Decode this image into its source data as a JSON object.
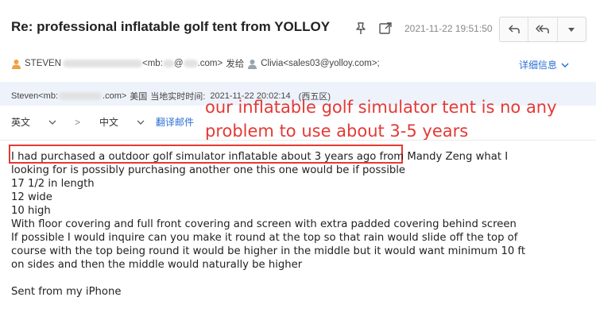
{
  "header": {
    "subject": "Re: professional inflatable golf tent from YOLLOY",
    "timestamp": "2021-11-22 19:51:50",
    "icons": [
      "pin-icon",
      "open-in-window-icon",
      "reply-icon",
      "reply-all-icon",
      "more-dropdown-icon"
    ]
  },
  "sender_row": {
    "from_prefix": "STEVEN",
    "from_suffix": "<mb:",
    "from_mid": "@",
    "from_end": ".com>",
    "sent_to_label": "发给",
    "recipient": "Clivia<sales03@yolloy.com>;",
    "details_label": "详细信息"
  },
  "quoted_sender": {
    "name_prefix": "Steven<mb:",
    "name_suffix": ".com>",
    "region": "美国",
    "local_time_label": "当地实时时间:",
    "local_time": "2021-11-22 20:02:14",
    "timezone": "(西五区)"
  },
  "translate": {
    "source_lang": "英文",
    "arrow": ">",
    "target_lang": "中文",
    "translate_label": "翻译邮件"
  },
  "annotation": {
    "line1": "our inflatable golf simulator tent is no any",
    "line2": "problem to use about 3-5 years",
    "color": "#e53935"
  },
  "body": {
    "lines": [
      "I had purchased a outdoor golf simulator inflatable about 3 years ago from Mandy Zeng what I",
      "looking for is possibly purchasing another one this one would be if possible",
      "17 1/2 in length",
      "12 wide",
      "10 high",
      "With floor covering and full front covering and screen with extra padded covering behind screen",
      "If possible I would inquire can you make it round at the top so that rain would slide off the top of",
      "course with the top being round it would be higher in the middle but it would want minimum 10 ft",
      "on sides and then the middle would naturally be higher",
      "",
      "Sent from my iPhone"
    ]
  },
  "colors": {
    "accent_blue": "#2b6fd6",
    "band_background": "#eef3fb",
    "annotation_red": "#e53935"
  }
}
